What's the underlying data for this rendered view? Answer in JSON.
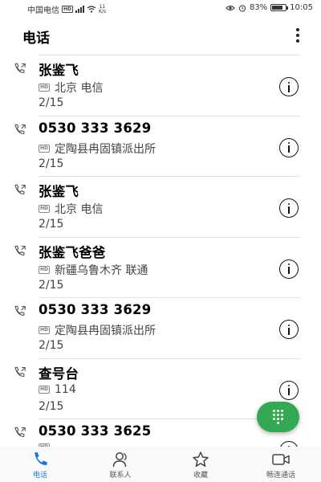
{
  "status_bar": {
    "carrier": "中国电信",
    "hd_label": "HD",
    "data_rate_value": "11",
    "data_rate_unit": "K/s",
    "battery": "83%",
    "battery_level": 0.83,
    "time": "10:05"
  },
  "header": {
    "title": "电话"
  },
  "calls": [
    {
      "name": "张鉴飞",
      "hd": "HD",
      "location": "北京 电信",
      "date": "2/15"
    },
    {
      "name": "0530 333 3629",
      "hd": "HD",
      "location": "定陶县冉固镇派出所",
      "date": "2/15"
    },
    {
      "name": "张鉴飞",
      "hd": "HD",
      "location": "北京 电信",
      "date": "2/15"
    },
    {
      "name": "张鉴飞爸爸",
      "hd": "HD",
      "location": "新疆乌鲁木齐 联通",
      "date": "2/15"
    },
    {
      "name": "0530 333 3629",
      "hd": "HD",
      "location": "定陶县冉固镇派出所",
      "date": "2/15"
    },
    {
      "name": "查号台",
      "hd": "HD",
      "location": "114",
      "date": "2/15"
    },
    {
      "name": "0530 333 3625",
      "hd": "HD",
      "location": "",
      "date": ""
    }
  ],
  "nav": [
    {
      "label": "电话",
      "icon": "phone-icon",
      "active": true
    },
    {
      "label": "联系人",
      "icon": "contacts-icon",
      "active": false
    },
    {
      "label": "收藏",
      "icon": "star-icon",
      "active": false
    },
    {
      "label": "畅连通话",
      "icon": "video-call-icon",
      "active": false
    }
  ],
  "colors": {
    "accent": "#1a73e8",
    "fab": "#34a853"
  }
}
